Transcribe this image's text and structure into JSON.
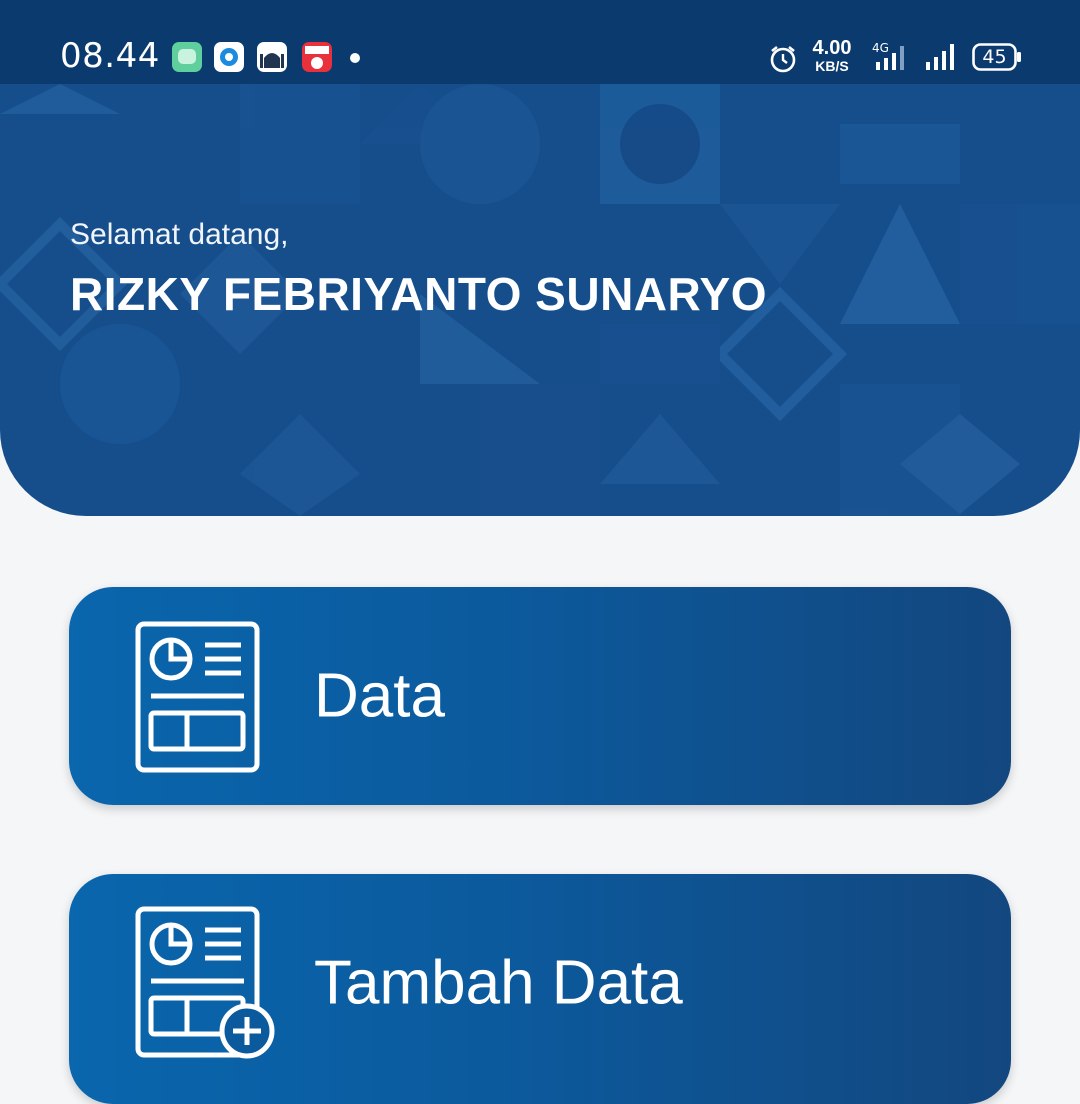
{
  "status_bar": {
    "time": "08.44",
    "net_speed_value": "4.00",
    "net_speed_unit": "KB/S",
    "network_type": "4G",
    "battery": "45",
    "icons": [
      "chat-app-icon",
      "circle-app-icon",
      "mosque-app-icon",
      "calendar-app-icon",
      "alarm-icon",
      "signal-icon",
      "battery-icon"
    ]
  },
  "header": {
    "greeting": "Selamat datang,",
    "username": "RIZKY FEBRIYANTO SUNARYO"
  },
  "menu": {
    "items": [
      {
        "label": "Data",
        "icon": "report-icon"
      },
      {
        "label": "Tambah Data",
        "icon": "report-add-icon"
      }
    ]
  },
  "colors": {
    "status_bar": "#0b3a6e",
    "header": "#164e8c",
    "card_start": "#0a66ad",
    "card_end": "#13477f",
    "background": "#f5f6f8"
  }
}
